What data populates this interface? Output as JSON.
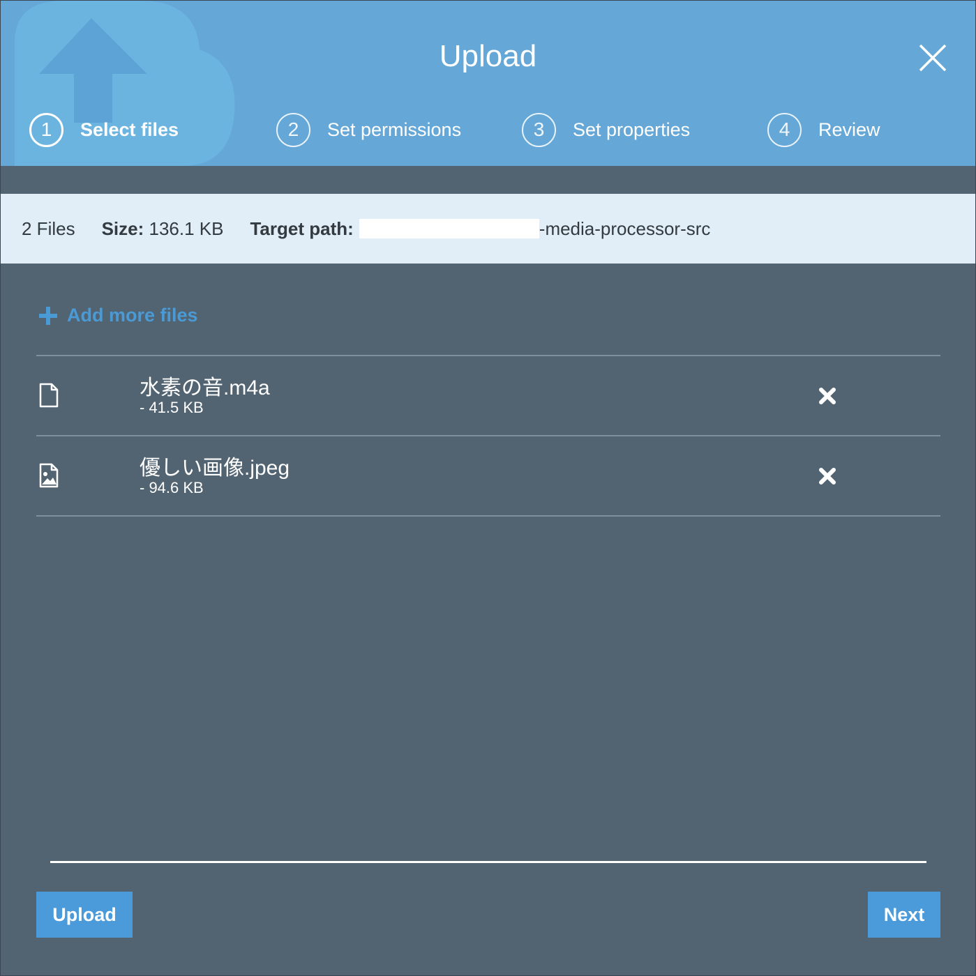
{
  "dialog": {
    "title": "Upload",
    "close_icon": "close-icon"
  },
  "steps": [
    {
      "number": "1",
      "label": "Select files",
      "active": true
    },
    {
      "number": "2",
      "label": "Set permissions",
      "active": false
    },
    {
      "number": "3",
      "label": "Set properties",
      "active": false
    },
    {
      "number": "4",
      "label": "Review",
      "active": false
    }
  ],
  "summary": {
    "file_count": "2 Files",
    "size_label": "Size:",
    "size_value": "136.1 KB",
    "target_label": "Target path:",
    "target_suffix": "-media-processor-src"
  },
  "add_more": {
    "label": "Add more files",
    "icon": "plus-icon"
  },
  "files": [
    {
      "name": "水素の音.m4a",
      "size": "- 41.5 KB",
      "icon": "file-icon"
    },
    {
      "name": "優しい画像.jpeg",
      "size": "- 94.6 KB",
      "icon": "image-file-icon"
    }
  ],
  "footer": {
    "upload_label": "Upload",
    "next_label": "Next"
  },
  "colors": {
    "header_bg": "#65a8d7",
    "body_bg": "#526472",
    "summary_bg": "#e1eef7",
    "accent": "#4b9ad9",
    "link": "#4a9ad6"
  }
}
